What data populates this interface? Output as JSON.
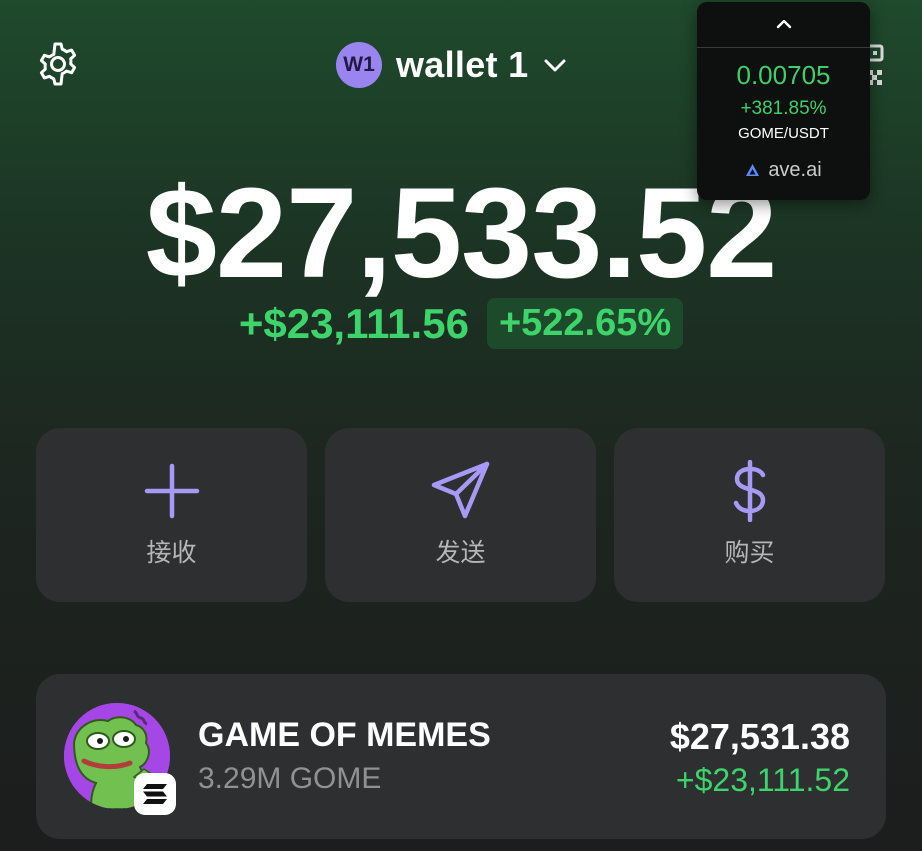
{
  "header": {
    "avatar_text": "W1",
    "wallet_name": "wallet 1",
    "settings_icon": "gear-icon",
    "dropdown_icon": "chevron-down-icon",
    "qr_icon": "qr-code-icon"
  },
  "ticker": {
    "collapse_icon": "chevron-up-icon",
    "price": "0.00705",
    "change": "+381.85%",
    "pair": "GOME/USDT",
    "source": "ave.ai",
    "source_icon": "ave-logo-icon"
  },
  "balance": {
    "total": "$27,533.52",
    "change_abs": "+$23,111.56",
    "change_pct": "+522.65%"
  },
  "actions": [
    {
      "label": "接收",
      "icon": "plus-icon"
    },
    {
      "label": "发送",
      "icon": "send-icon"
    },
    {
      "label": "购买",
      "icon": "dollar-icon"
    }
  ],
  "tokens": [
    {
      "name": "GAME OF MEMES",
      "amount": "3.29M GOME",
      "value": "$27,531.38",
      "change": "+$23,111.52",
      "icon": "pepe-token-icon",
      "chain_icon": "solana-icon"
    }
  ],
  "colors": {
    "positive": "#3ed46c",
    "accent": "#9a85f0",
    "card": "#2d2f30"
  }
}
